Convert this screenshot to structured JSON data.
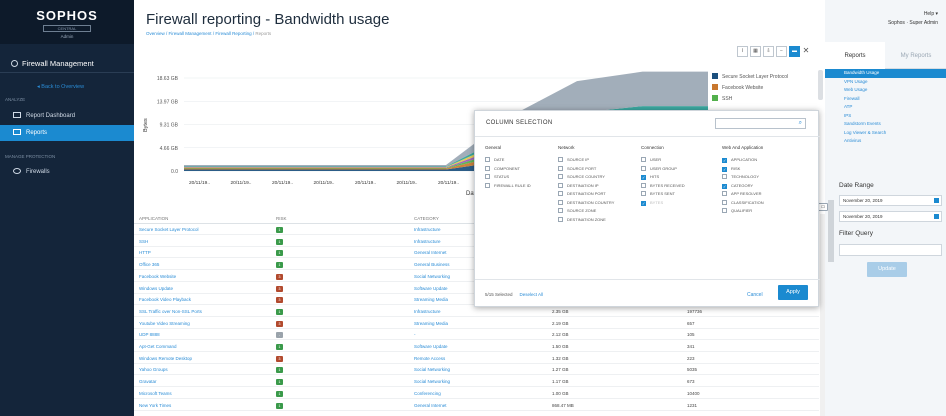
{
  "brand": {
    "logo": "SOPHOS",
    "logo_sub": "CENTRAL",
    "role": "Admin"
  },
  "nav": {
    "header": "Firewall Management",
    "back": "Back to Overview",
    "section_analyze": "ANALYZE",
    "items": [
      {
        "label": "Report Dashboard",
        "active": false
      },
      {
        "label": "Reports",
        "active": true
      }
    ],
    "section_manage": "MANAGE PROTECTION",
    "firewalls": "Firewalls"
  },
  "page": {
    "title": "Firewall reporting - Bandwidth usage",
    "breadcrumb": [
      "Overview",
      "Firewall Management",
      "Firewall Reporting",
      "Reports"
    ]
  },
  "toolbar": [
    "lin",
    "grid",
    "export",
    "minus",
    "folder",
    "close"
  ],
  "help": {
    "label": "Help ▾",
    "user": "Sophos · Super Admin"
  },
  "tabs": [
    "Reports",
    "My Reports"
  ],
  "reports_list": [
    {
      "label": "Bandwidth Usage",
      "active": true
    },
    {
      "label": "VPN Usage"
    },
    {
      "label": "Web Usage"
    },
    {
      "label": "Firewall"
    },
    {
      "label": "ATP"
    },
    {
      "label": "IPS"
    },
    {
      "label": "Sandstorm Events"
    },
    {
      "label": "Log Viewer & Search"
    },
    {
      "label": "Antivirus"
    }
  ],
  "date_range": {
    "label": "Date Range",
    "from": "November 20, 2019",
    "to": "November 20, 2019"
  },
  "filter": {
    "label": "Filter Query",
    "placeholder": "",
    "button": "Update"
  },
  "chart_data": {
    "type": "area",
    "xlabel": "Date",
    "ylabel": "Bytes",
    "y_ticks": [
      "18.63 GB",
      "13.97 GB",
      "9.31 GB",
      "4.66 GB",
      "0.0"
    ],
    "x_ticks": [
      "20/11/19..",
      "20/11/19..",
      "20/11/19..",
      "20/11/19..",
      "20/11/19..",
      "20/11/19..",
      "20/11/19.."
    ],
    "legend": [
      {
        "name": "Secure Socket Layer Protocol",
        "color": "#1b4f7d"
      },
      {
        "name": "Facebook Website",
        "color": "#c9772d"
      },
      {
        "name": "SSH",
        "color": "#52b04c"
      }
    ],
    "series": [
      {
        "name": "Secure Socket Layer Protocol",
        "color": "#1b4f7d",
        "values": [
          0.3,
          0.3,
          0.3,
          0.3,
          0.3,
          2.2,
          3.2,
          3.6,
          3.6
        ]
      },
      {
        "name": "Facebook Website",
        "color": "#c9772d",
        "values": [
          0.2,
          0.2,
          0.2,
          0.2,
          0.2,
          1.4,
          2.0,
          2.2,
          2.2
        ]
      },
      {
        "name": "SSH",
        "color": "#52b04c",
        "values": [
          0.1,
          0.1,
          0.1,
          0.1,
          0.1,
          1.0,
          1.6,
          1.8,
          1.8
        ]
      },
      {
        "name": "",
        "color": "#9b59b6",
        "values": [
          0.1,
          0.1,
          0.1,
          0.1,
          0.1,
          1.0,
          1.6,
          1.8,
          1.8
        ]
      },
      {
        "name": "",
        "color": "#e2c84a",
        "values": [
          0.1,
          0.1,
          0.1,
          0.1,
          0.1,
          1.0,
          1.6,
          1.8,
          1.8
        ]
      },
      {
        "name": "",
        "color": "#2aa198",
        "values": [
          0.1,
          0.1,
          0.1,
          0.1,
          0.1,
          1.0,
          1.6,
          1.8,
          1.8
        ]
      },
      {
        "name": "",
        "color": "#9aa7b4",
        "values": [
          0.3,
          0.3,
          0.3,
          0.3,
          0.3,
          3.5,
          6.4,
          6.9,
          6.9
        ]
      }
    ],
    "ylim": [
      0,
      18.63
    ]
  },
  "table": {
    "headers": [
      "APPLICATION",
      "RISK",
      "CATEGORY"
    ],
    "rows": [
      {
        "app": "Secure Socket Layer Protocol",
        "risk": "1",
        "cat": "Infrastructure",
        "bytes": "",
        "hits": ""
      },
      {
        "app": "SSH",
        "risk": "1",
        "cat": "Infrastructure",
        "bytes": "",
        "hits": ""
      },
      {
        "app": "HTTP",
        "risk": "1",
        "cat": "General Internet",
        "bytes": "",
        "hits": ""
      },
      {
        "app": "Office 365",
        "risk": "1",
        "cat": "General Business",
        "bytes": "",
        "hits": ""
      },
      {
        "app": "Facebook Website",
        "risk": "3",
        "cat": "Social Networking",
        "bytes": "",
        "hits": ""
      },
      {
        "app": "Windows Update",
        "risk": "3",
        "cat": "Software Update",
        "bytes": "",
        "hits": ""
      },
      {
        "app": "Facebook Video Playback",
        "risk": "3",
        "cat": "Streaming Media",
        "bytes": "",
        "hits": ""
      },
      {
        "app": "SSL Traffic over Non-SSL Ports",
        "risk": "1",
        "cat": "Infrastructure",
        "bytes": "2.35 GB",
        "hits": "197736"
      },
      {
        "app": "Youtube Video Streaming",
        "risk": "3",
        "cat": "Streaming Media",
        "bytes": "2.19 GB",
        "hits": "657"
      },
      {
        "app": "UDP 8888",
        "risk": "-",
        "cat": "-",
        "bytes": "2.12 GB",
        "hits": "105"
      },
      {
        "app": "Apt-Get Command",
        "risk": "1",
        "cat": "Software Update",
        "bytes": "1.50 GB",
        "hits": "341"
      },
      {
        "app": "Windows Remote Desktop",
        "risk": "3",
        "cat": "Remote Access",
        "bytes": "1.32 GB",
        "hits": "223"
      },
      {
        "app": "Yahoo Groups",
        "risk": "1",
        "cat": "Social Networking",
        "bytes": "1.27 GB",
        "hits": "5035"
      },
      {
        "app": "Gravatar",
        "risk": "1",
        "cat": "Social Networking",
        "bytes": "1.17 GB",
        "hits": "673"
      },
      {
        "app": "Microsoft Teams",
        "risk": "1",
        "cat": "Conferencing",
        "bytes": "1.00 GB",
        "hits": "10400"
      },
      {
        "app": "New York Times",
        "risk": "1",
        "cat": "General Internet",
        "bytes": "868.47 MB",
        "hits": "1231"
      }
    ]
  },
  "modal": {
    "title": "COLUMN SELECTION",
    "search_placeholder": "",
    "columns": [
      {
        "title": "General",
        "items": [
          {
            "label": "DATE",
            "on": false
          },
          {
            "label": "COMPONENT",
            "on": false
          },
          {
            "label": "STATUS",
            "on": false
          },
          {
            "label": "FIREWALL RULE ID",
            "on": false
          }
        ]
      },
      {
        "title": "Network",
        "items": [
          {
            "label": "SOURCE IP",
            "on": false
          },
          {
            "label": "SOURCE PORT",
            "on": false
          },
          {
            "label": "SOURCE COUNTRY",
            "on": false
          },
          {
            "label": "DESTINATION IP",
            "on": false
          },
          {
            "label": "DESTINATION PORT",
            "on": false
          },
          {
            "label": "DESTINATION COUNTRY",
            "on": false
          },
          {
            "label": "SOURCE ZONE",
            "on": false
          },
          {
            "label": "DESTINATION ZONE",
            "on": false
          }
        ]
      },
      {
        "title": "Connection",
        "items": [
          {
            "label": "USER",
            "on": false
          },
          {
            "label": "USER GROUP",
            "on": false
          },
          {
            "label": "HITS",
            "on": true
          },
          {
            "label": "BYTES RECEIVED",
            "on": false
          },
          {
            "label": "BYTES SENT",
            "on": false
          },
          {
            "label": "BYTES",
            "on": true,
            "disabled": true
          }
        ]
      },
      {
        "title": "Web And Application",
        "items": [
          {
            "label": "APPLICATION",
            "on": true
          },
          {
            "label": "RISK",
            "on": true
          },
          {
            "label": "TECHNOLOGY",
            "on": false
          },
          {
            "label": "CATEGORY",
            "on": true
          },
          {
            "label": "APP RESOLVER",
            "on": false
          },
          {
            "label": "CLASSIFICATION",
            "on": false
          },
          {
            "label": "QUALIFIER",
            "on": false
          }
        ]
      }
    ],
    "selected": "5/15 Selected",
    "deselect": "Deselect All",
    "cancel": "Cancel",
    "apply": "Apply"
  },
  "risk_colors": {
    "1": "#3a9a4a",
    "3": "#b24a2e",
    "-": "#9aa3ab"
  }
}
